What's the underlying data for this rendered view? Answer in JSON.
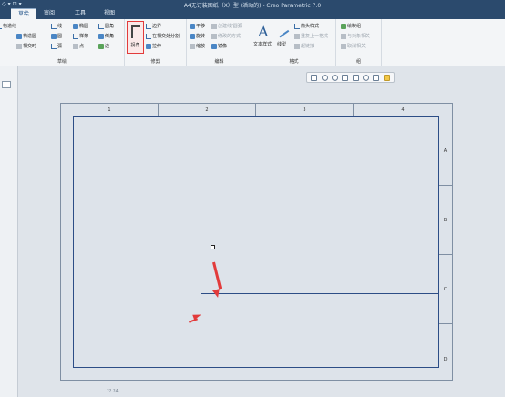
{
  "window": {
    "title": "A4无订装图纸（X）型 (活动的) - Creo Parametric 7.0",
    "qat": [
      "◇",
      "▾",
      "⊡",
      "▾"
    ]
  },
  "menu": {
    "tabs": [
      {
        "label": "",
        "active": false
      },
      {
        "label": "草绘",
        "active": true
      },
      {
        "label": "审阅",
        "active": false
      },
      {
        "label": "工具",
        "active": false
      },
      {
        "label": "视图",
        "active": false
      }
    ]
  },
  "ribbon": {
    "sketch_group": {
      "label": "草绘",
      "items": [
        "构造线",
        "构造圆",
        "相交时",
        "线",
        "圆",
        "弧",
        "椭圆",
        "样条",
        "点",
        "圆角",
        "倒角",
        "边"
      ]
    },
    "edit_trim_group": {
      "label": "修剪",
      "big_button": "拐角",
      "items": [
        "边界",
        "在相交处分割",
        "拉伸"
      ]
    },
    "edit_group": {
      "label": "编辑",
      "items": [
        "平移",
        "旋转",
        "缩放",
        "创建线/圆弧",
        "修改的方式",
        "镜像"
      ]
    },
    "format_group": {
      "label": "格式",
      "items": [
        "文本样式",
        "线型",
        "箭头样式",
        "重复上一格式",
        "超链接"
      ]
    },
    "group_group": {
      "label": "组",
      "items": [
        "绘制组",
        "与对象相关",
        "取消相关"
      ]
    }
  },
  "drawing": {
    "columns": [
      "1",
      "2",
      "3",
      "4"
    ],
    "rows": [
      "A",
      "B",
      "C",
      "D"
    ]
  },
  "status": {
    "coords": "??  ?4"
  },
  "colors": {
    "titlebar": "#2b4a6d",
    "ribbon_bg": "#f3f5f7",
    "frame": "#2c4d86",
    "highlight": "#e23b3b"
  }
}
